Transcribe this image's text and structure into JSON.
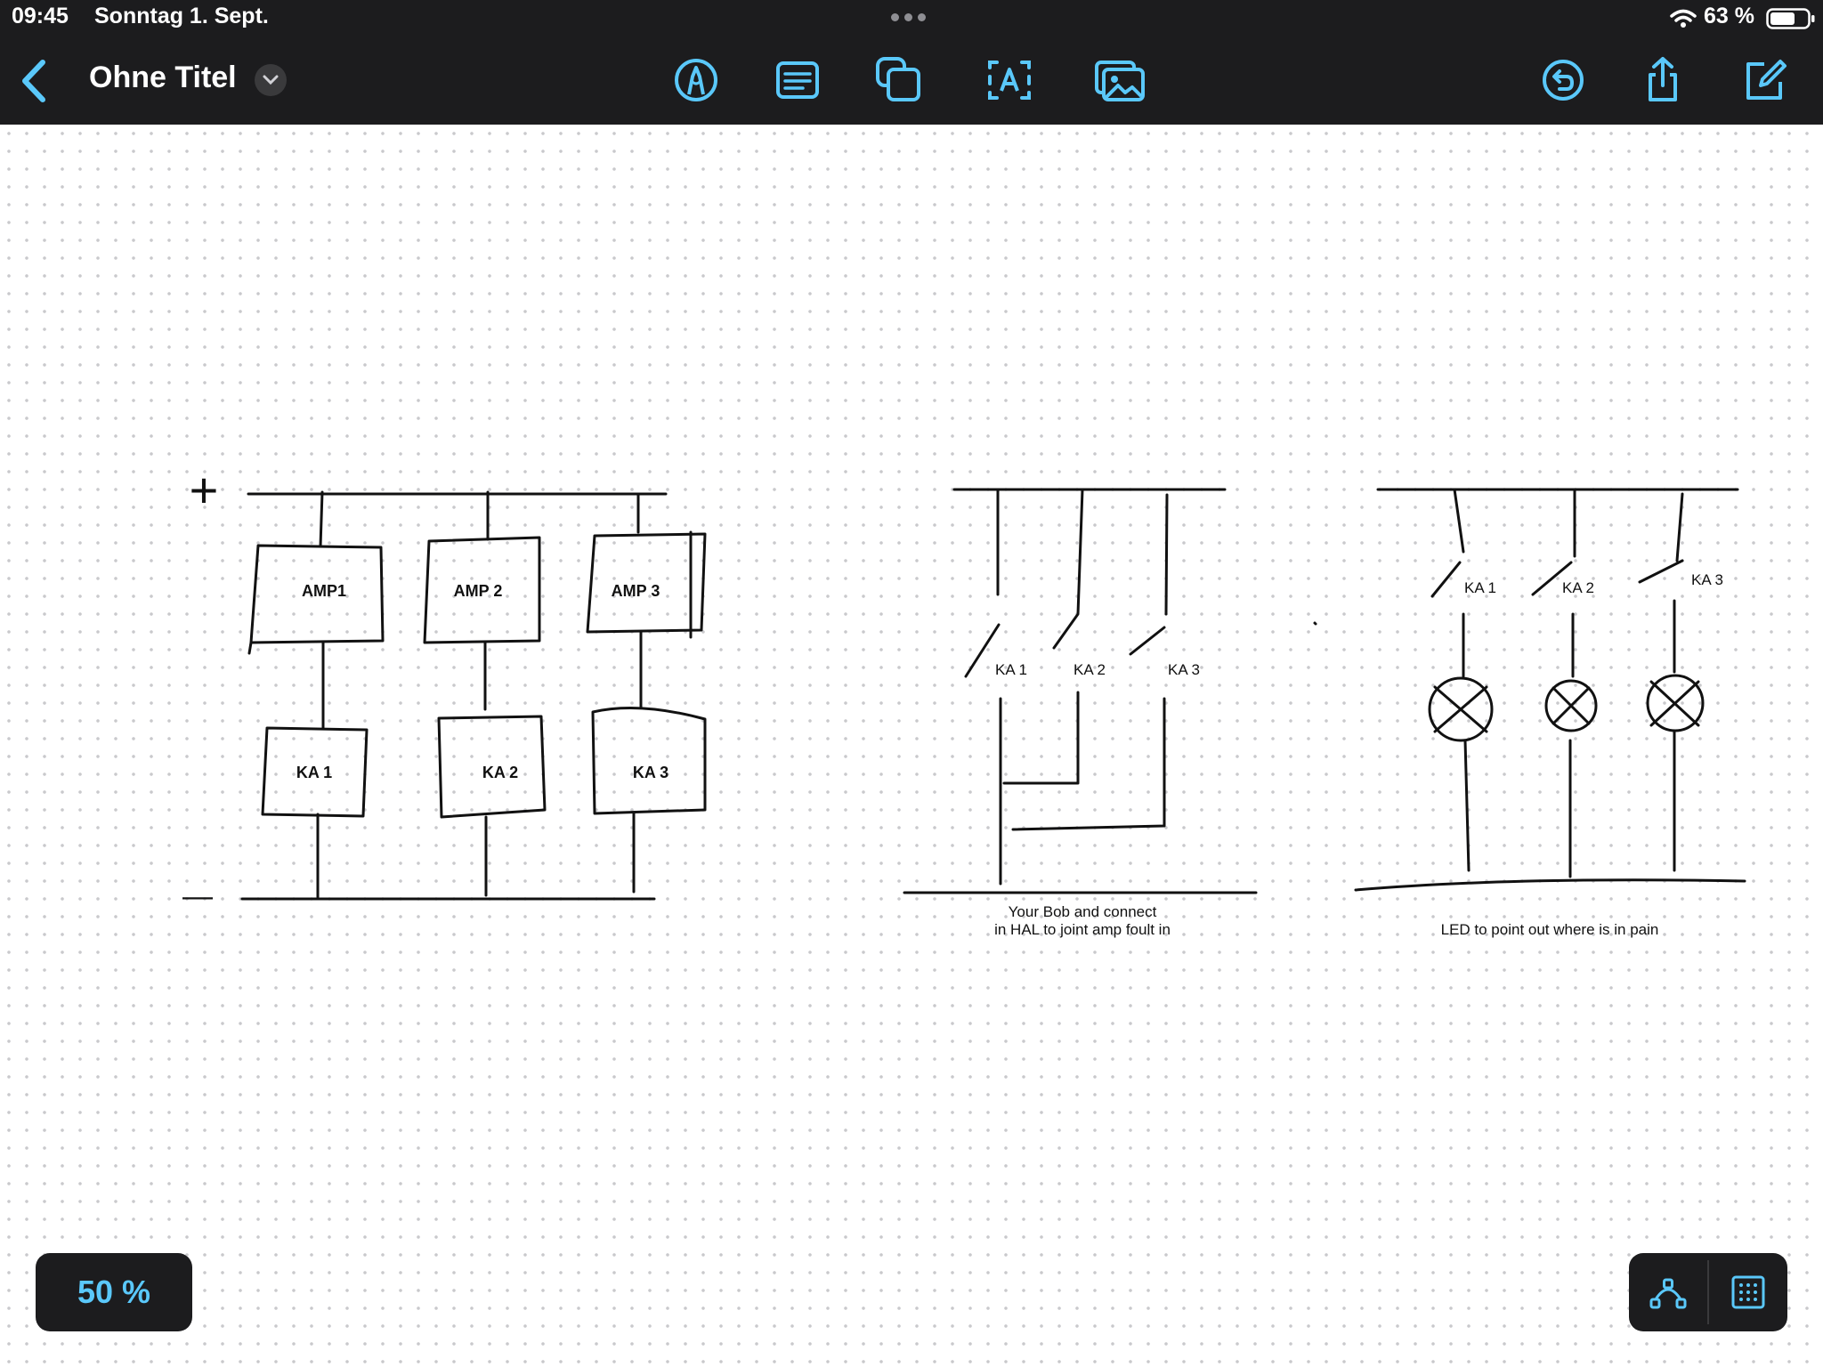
{
  "status_bar": {
    "time": "09:45",
    "date": "Sonntag 1. Sept.",
    "battery": "63 %"
  },
  "toolbar": {
    "title": "Ohne Titel",
    "accent_color": "#5ac8fa",
    "tools": [
      "pen-tool-icon",
      "text-box-icon",
      "shapes-icon",
      "text-icon",
      "photo-icon"
    ],
    "right_tools": [
      "undo-icon",
      "share-icon",
      "compose-icon"
    ]
  },
  "canvas": {
    "drawing1": {
      "plus": "+",
      "minus": "—",
      "amps": [
        "AMP1",
        "AMP 2",
        "AMP 3"
      ],
      "relays": [
        "KA 1",
        "KA 2",
        "KA 3"
      ]
    },
    "drawing2": {
      "contacts": [
        "KA 1",
        "KA 2",
        "KA 3"
      ],
      "caption_line1": "Your Bob and connect",
      "caption_line2": "in HAL to joint amp foult in"
    },
    "drawing3": {
      "contacts": [
        "KA 1",
        "KA 2",
        "KA 3"
      ],
      "caption": "LED to point out where is in pain"
    }
  },
  "zoom": {
    "label": "50 %"
  },
  "bottom_tools": [
    "lasso-icon",
    "grid-icon"
  ]
}
